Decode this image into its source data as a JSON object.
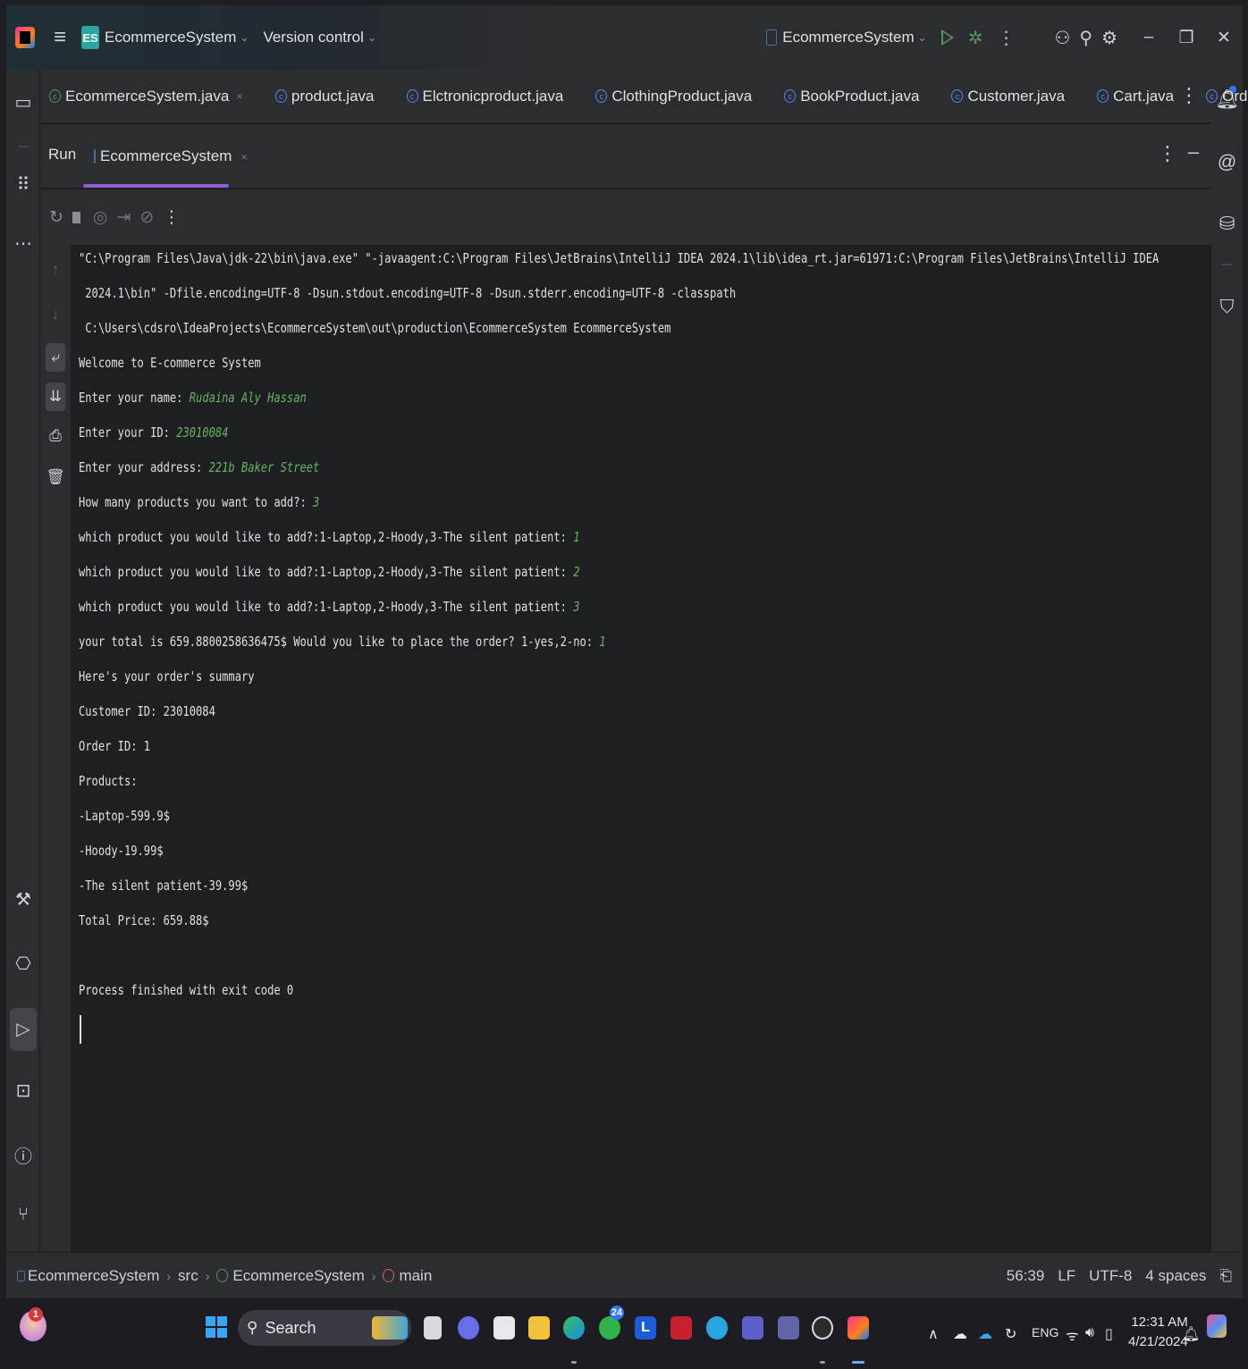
{
  "titlebar": {
    "project_badge": "ES",
    "project_name": "EcommerceSystem",
    "vcs_label": "Version control",
    "run_config": "EcommerceSystem",
    "chevron": "⌄"
  },
  "tabs": [
    {
      "label": "EcommerceSystem.java",
      "close": "×",
      "icon": "class-main-icon"
    },
    {
      "label": "product.java",
      "icon": "class-icon"
    },
    {
      "label": "Elctronicproduct.java",
      "icon": "class-icon"
    },
    {
      "label": "ClothingProduct.java",
      "icon": "class-icon"
    },
    {
      "label": "BookProduct.java",
      "icon": "class-icon"
    },
    {
      "label": "Customer.java",
      "icon": "class-icon"
    },
    {
      "label": "Cart.java",
      "icon": "class-icon"
    },
    {
      "label": "Order.java",
      "icon": "class-icon"
    }
  ],
  "run_panel": {
    "title": "Run",
    "tab_label": "EcommerceSystem",
    "tab_close": "×"
  },
  "console": {
    "lines": [
      {
        "text": "\"C:\\Program Files\\Java\\jdk-22\\bin\\java.exe\" \"-javaagent:C:\\Program Files\\JetBrains\\IntelliJ IDEA 2024.1\\lib\\idea_rt.jar=61971:C:\\Program Files\\JetBrains\\IntelliJ IDEA",
        "input": ""
      },
      {
        "text": " 2024.1\\bin\" -Dfile.encoding=UTF-8 -Dsun.stdout.encoding=UTF-8 -Dsun.stderr.encoding=UTF-8 -classpath",
        "input": ""
      },
      {
        "text": " C:\\Users\\cdsro\\IdeaProjects\\EcommerceSystem\\out\\production\\EcommerceSystem EcommerceSystem",
        "input": ""
      },
      {
        "text": "Welcome to E-commerce System",
        "input": ""
      },
      {
        "text": "Enter your name: ",
        "input": "Rudaina Aly Hassan"
      },
      {
        "text": "Enter your ID: ",
        "input": "23010084"
      },
      {
        "text": "Enter your address: ",
        "input": "221b Baker Street"
      },
      {
        "text": "How many products you want to add?: ",
        "input": "3"
      },
      {
        "text": "which product you would like to add?:1-Laptop,2-Hoody,3-The silent patient: ",
        "input": "1"
      },
      {
        "text": "which product you would like to add?:1-Laptop,2-Hoody,3-The silent patient: ",
        "input": "2"
      },
      {
        "text": "which product you would like to add?:1-Laptop,2-Hoody,3-The silent patient: ",
        "input": "3"
      },
      {
        "text": "your total is 659.8800258636475$ Would you like to place the order? 1-yes,2-no: ",
        "input": "1"
      },
      {
        "text": "Here's your order's summary",
        "input": ""
      },
      {
        "text": "Customer ID: 23010084",
        "input": ""
      },
      {
        "text": "Order ID: 1",
        "input": ""
      },
      {
        "text": "Products:",
        "input": ""
      },
      {
        "text": "-Laptop-599.9$",
        "input": ""
      },
      {
        "text": "-Hoody-19.99$",
        "input": ""
      },
      {
        "text": "-The silent patient-39.99$",
        "input": ""
      },
      {
        "text": "Total Price: 659.88$",
        "input": ""
      },
      {
        "text": "",
        "input": ""
      },
      {
        "text": "Process finished with exit code 0",
        "input": ""
      }
    ]
  },
  "statusbar": {
    "breadcrumb": [
      "EcommerceSystem",
      "src",
      "EcommerceSystem",
      "main"
    ],
    "separator": "›",
    "position": "56:39",
    "line_sep": "LF",
    "encoding": "UTF-8",
    "indent": "4 spaces"
  },
  "taskbar": {
    "widget_badge": "1",
    "search_label": "Search",
    "whatsapp_badge": "24",
    "lang": "ENG",
    "time": "12:31 AM",
    "date": "4/21/2024"
  },
  "colors": {
    "accent": "#8d5fd3",
    "input_text": "#67b45f",
    "background": "#1e1f22",
    "panel": "#2b2d30"
  }
}
